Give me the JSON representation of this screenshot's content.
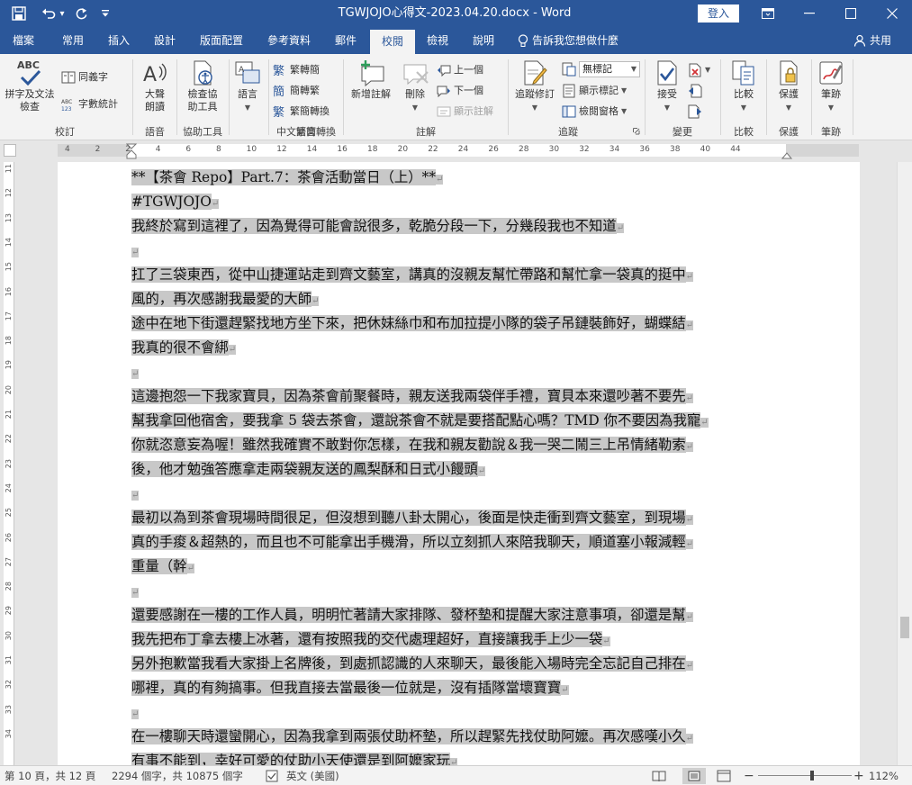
{
  "window": {
    "title": "TGWJOJO心得文-2023.04.20.docx  -  Word",
    "login_label": "登入",
    "minimize_glyph": "—",
    "maximize_glyph": "☐",
    "close_glyph": "✕",
    "ribbon_display_glyph": "⧉"
  },
  "quick_access": {
    "save_glyph": "🖫",
    "undo_glyph": "↶",
    "undo_dropdown_glyph": "▾",
    "redo_glyph": "↻",
    "customize_glyph": "⇣"
  },
  "tabs": [
    "檔案",
    "常用",
    "插入",
    "設計",
    "版面配置",
    "參考資料",
    "郵件",
    "校閱",
    "檢視",
    "說明"
  ],
  "active_tab": "校閱",
  "tell_me": "告訴我您想做什麼",
  "share": "共用",
  "ribbon": {
    "groups": {
      "proofing": "校訂",
      "speech": "語音",
      "accessibility": "協助工具",
      "language": "語言",
      "chinese_conversion": "中文繁簡轉換",
      "comments": "註解",
      "tracking": "追蹤",
      "changes": "變更",
      "compare": "比較",
      "protect": "保護",
      "ink": "筆跡"
    },
    "spelling_line1": "拼字及文法",
    "spelling_line2": "檢查",
    "abc_text": "ABC",
    "thesaurus": "同義字",
    "word_count": "字數統計",
    "read_aloud_line1": "大聲",
    "read_aloud_line2": "朗讀",
    "check_access_line1": "檢查協",
    "check_access_line2": "助工具",
    "language_btn": "語言",
    "to_traditional": "繁轉簡",
    "to_simplified": "簡轉繁",
    "convert": "繁簡轉換",
    "new_comment": "新增註解",
    "delete": "刪除",
    "previous": "上一個",
    "next": "下一個",
    "show_comments": "顯示註解",
    "track_changes": "追蹤修訂",
    "markup_select": "無標記",
    "show_markup": "顯示標記",
    "reviewing_pane": "檢閱窗格",
    "accept": "接受",
    "compare_btn": "比較",
    "protect_btn": "保護",
    "ink_btn": "筆跡"
  },
  "ruler_numbers": [
    "4",
    "2",
    "2",
    "4",
    "6",
    "8",
    "10",
    "12",
    "14",
    "16",
    "18",
    "20",
    "22",
    "24",
    "26",
    "28",
    "30",
    "32",
    "34",
    "36",
    "38",
    "40",
    "44"
  ],
  "vruler_numbers": [
    "11",
    "12",
    "13",
    "14",
    "15",
    "16",
    "17",
    "18",
    "19",
    "20",
    "21",
    "22",
    "23",
    "24",
    "25",
    "26",
    "27",
    "28",
    "29",
    "30",
    "31",
    "32",
    "33",
    "34"
  ],
  "document": {
    "lines": [
      "**【茶會 Repo】Part.7：茶會活動當日（上）**",
      "#TGWJOJO",
      "我終於寫到這裡了，因為覺得可能會說很多，乾脆分段一下，分幾段我也不知道",
      "",
      "扛了三袋東西，從中山捷運站走到齊文藝室，講真的沒親友幫忙帶路和幫忙拿一袋真的挺中",
      "風的，再次感謝我最愛的大師",
      "途中在地下街還趕緊找地方坐下來，把休妹絲巾和布加拉提小隊的袋子吊鏈裝飾好，蝴蝶結",
      "我真的很不會綁",
      "",
      "這邊抱怨一下我家寶貝，因為茶會前聚餐時，親友送我兩袋伴手禮，寶貝本來還吵著不要先",
      "幫我拿回他宿舍，要我拿 5 袋去茶會，還說茶會不就是要搭配點心嗎？TMD 你不要因為我寵",
      "你就恣意妄為喔！雖然我確實不敢對你怎樣，在我和親友勸說＆我一哭二鬧三上吊情緒勒索",
      "後，他才勉強答應拿走兩袋親友送的鳳梨酥和日式小饅頭",
      "",
      "最初以為到茶會現場時間很足，但沒想到聽八卦太開心，後面是快走衝到齊文藝室，到現場",
      "真的手痠＆超熱的，而且也不可能拿出手機滑，所以立刻抓人來陪我聊天，順道塞小報減輕",
      "重量（幹",
      "",
      "還要感謝在一樓的工作人員，明明忙著請大家排隊、發杯墊和提醒大家注意事項，卻還是幫",
      "我先把布丁拿去樓上冰著，還有按照我的交代處理超好，直接讓我手上少一袋",
      "另外抱歉當我看大家掛上名牌後，到處抓認識的人來聊天，最後能入場時完全忘記自己排在",
      "哪裡，真的有夠搞事。但我直接去當最後一位就是，沒有插隊當壞寶寶",
      "",
      "在一樓聊天時還蠻開心，因為我拿到兩張仗助杯墊，所以趕緊先找仗助阿嬤。再次感嘆小久",
      "有事不能到，幸好可愛的仗助小天使還是到阿嬤家玩"
    ],
    "para_mark": "↵"
  },
  "status": {
    "page": "第 10 頁，共 12 頁",
    "words": "2294 個字，共 10875 個字",
    "language": "英文 (美國)",
    "zoom": "112%",
    "zoom_fraction": 0.58
  }
}
